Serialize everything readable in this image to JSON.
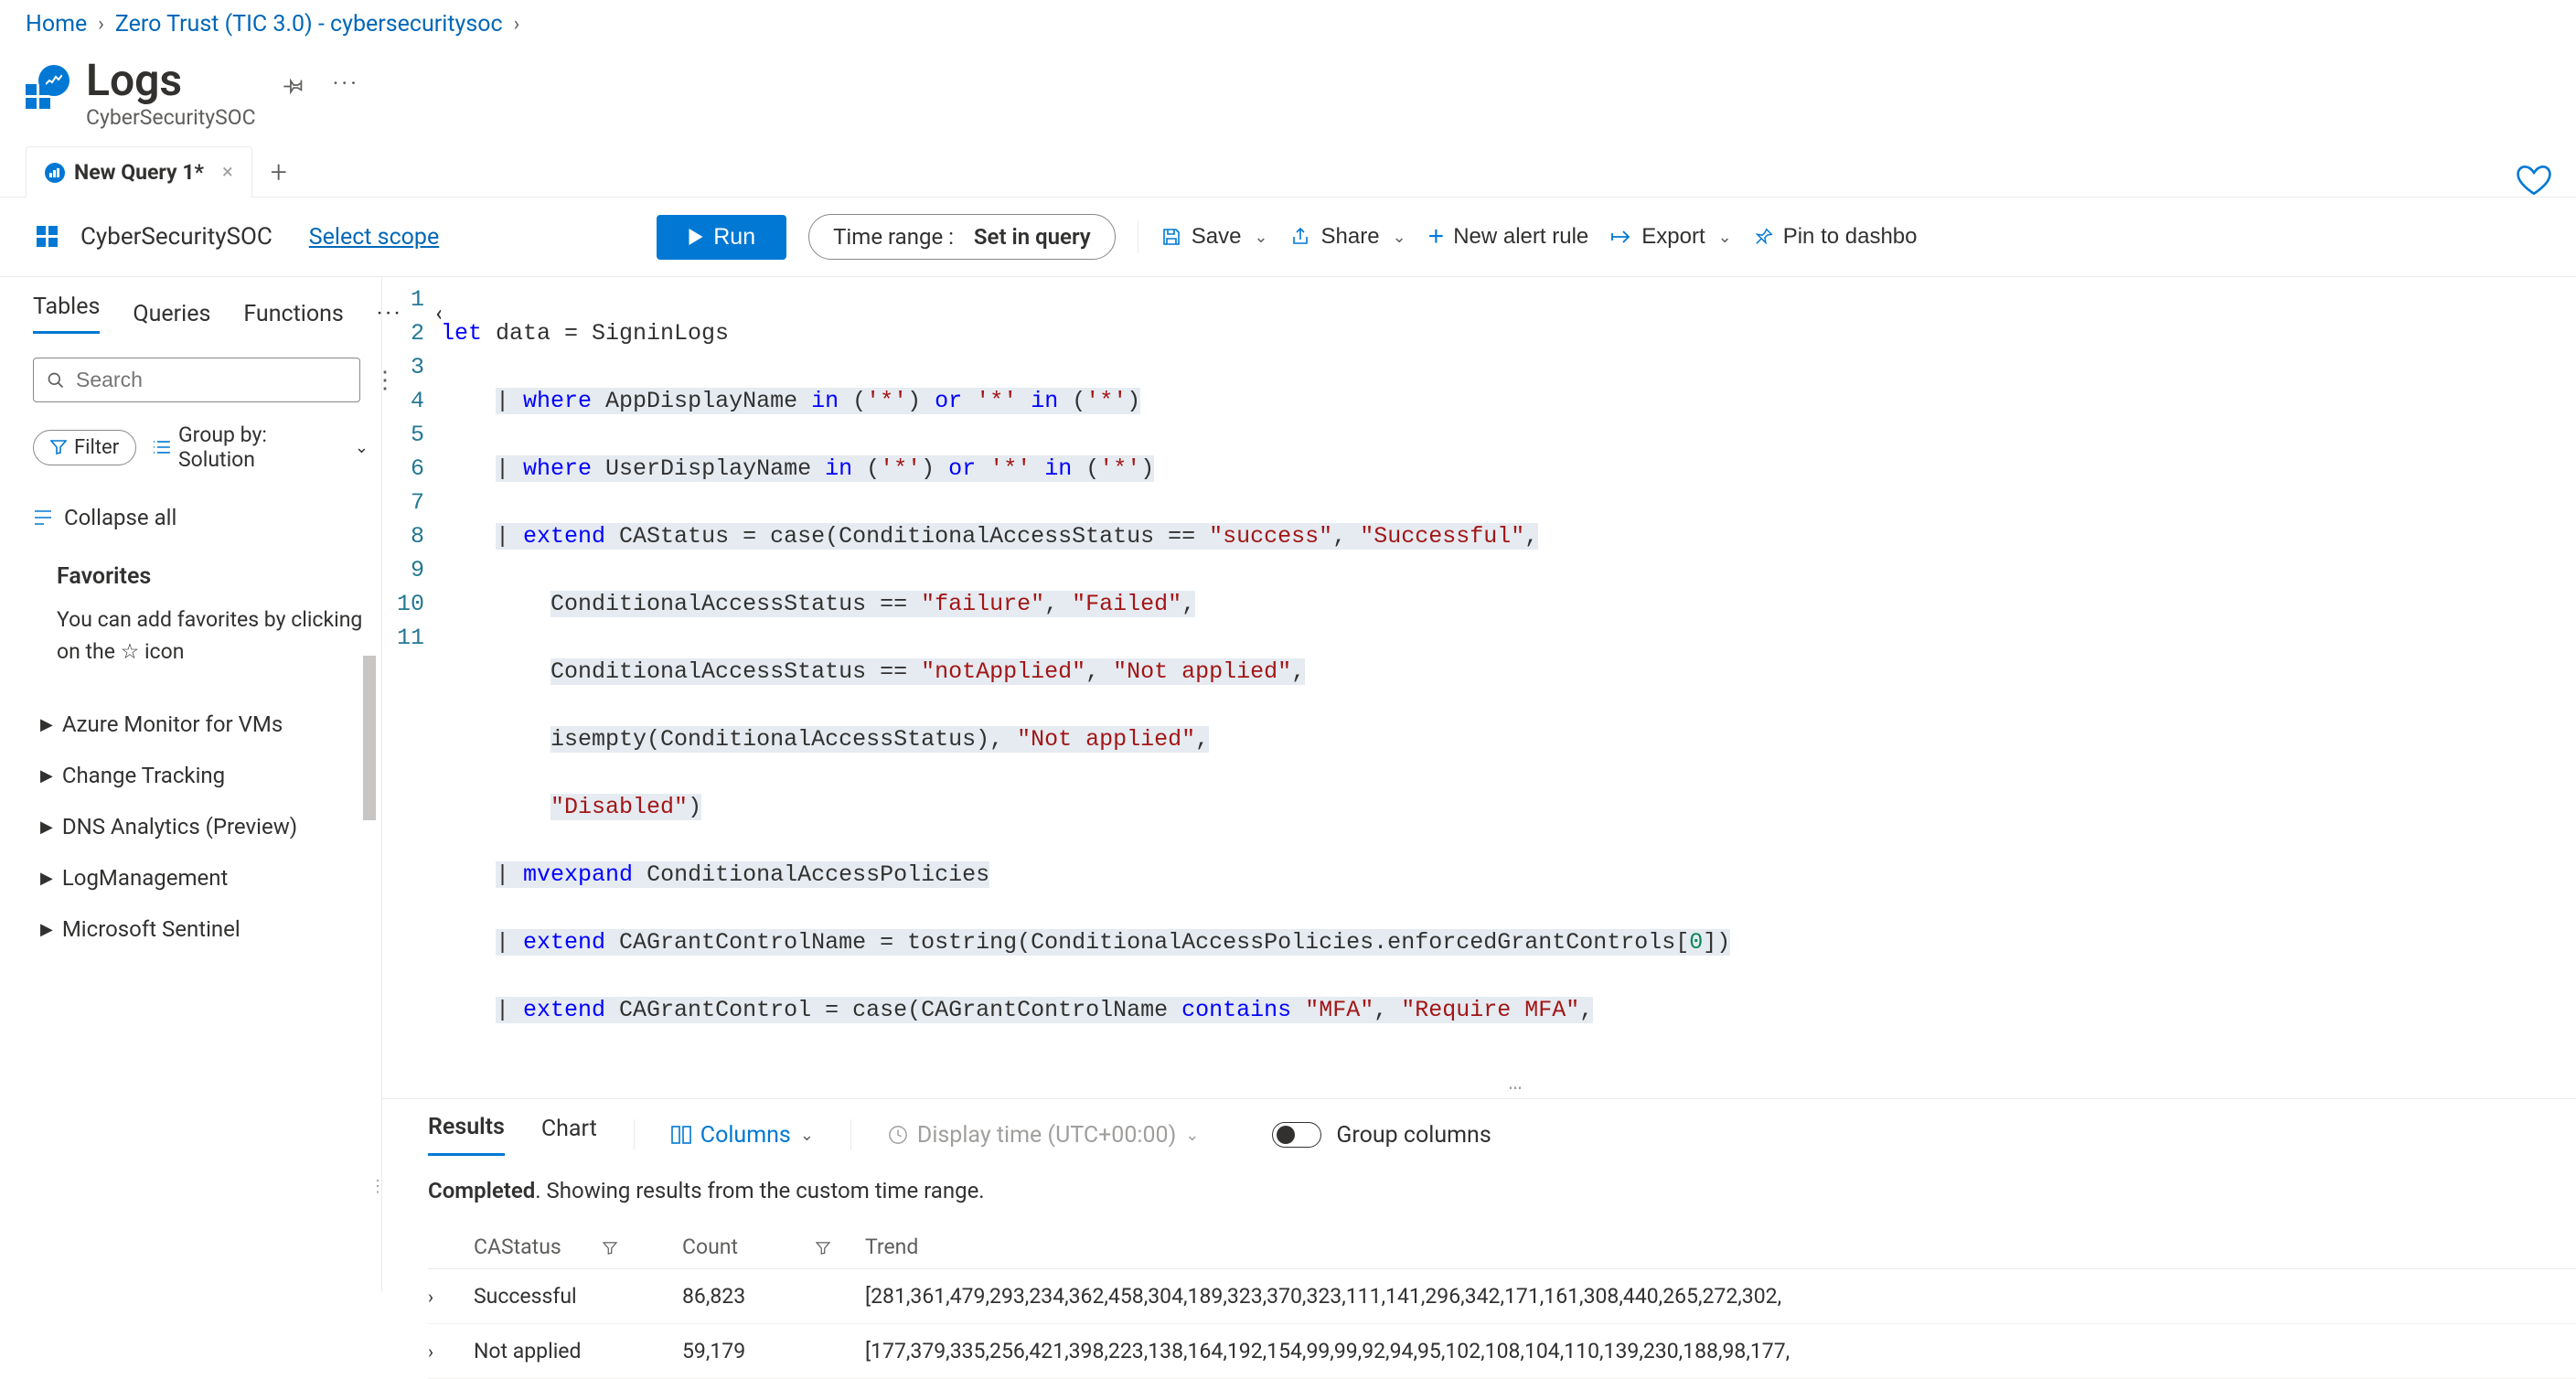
{
  "breadcrumb": {
    "home": "Home",
    "mid": "Zero Trust (TIC 3.0) - cybersecuritysoc"
  },
  "header": {
    "title": "Logs",
    "subtitle": "CyberSecuritySOC"
  },
  "tabs": {
    "query1": "New Query 1*"
  },
  "scope": {
    "name": "CyberSecuritySOC",
    "select": "Select scope"
  },
  "toolbar": {
    "run": "Run",
    "timerange_label": "Time range :",
    "timerange_value": "Set in query",
    "save": "Save",
    "share": "Share",
    "newalert": "New alert rule",
    "export": "Export",
    "pin": "Pin to dashbo"
  },
  "sidebar": {
    "tabs": {
      "tables": "Tables",
      "queries": "Queries",
      "functions": "Functions"
    },
    "search_placeholder": "Search",
    "filter": "Filter",
    "groupby": "Group by: Solution",
    "collapse_all": "Collapse all",
    "favorites_title": "Favorites",
    "favorites_hint": "You can add favorites by clicking on the ☆ icon",
    "tree": [
      "Azure Monitor for VMs",
      "Change Tracking",
      "DNS Analytics (Preview)",
      "LogManagement",
      "Microsoft Sentinel"
    ]
  },
  "editor": {
    "lines": [
      "let data = SigninLogs",
      "    | where AppDisplayName in ('*') or '*' in ('*')",
      "    | where UserDisplayName in ('*') or '*' in ('*')",
      "    | extend CAStatus = case(ConditionalAccessStatus == \"success\", \"Successful\",",
      "        ConditionalAccessStatus == \"failure\", \"Failed\",",
      "        ConditionalAccessStatus == \"notApplied\", \"Not applied\",",
      "        isempty(ConditionalAccessStatus), \"Not applied\",",
      "        \"Disabled\")",
      "    | mvexpand ConditionalAccessPolicies",
      "    | extend CAGrantControlName = tostring(ConditionalAccessPolicies.enforcedGrantControls[0])",
      "    | extend CAGrantControl = case(CAGrantControlName contains \"MFA\", \"Require MFA\","
    ]
  },
  "results": {
    "tab_results": "Results",
    "tab_chart": "Chart",
    "columns": "Columns",
    "displaytime": "Display time (UTC+00:00)",
    "groupcols": "Group columns",
    "status_bold": "Completed",
    "status_rest": ". Showing results from the custom time range.",
    "headers": {
      "castatus": "CAStatus",
      "count": "Count",
      "trend": "Trend"
    },
    "rows": [
      {
        "castatus": "Successful",
        "count": "86,823",
        "trend": "[281,361,479,293,234,362,458,304,189,323,370,323,111,141,296,342,171,161,308,440,265,272,302,"
      },
      {
        "castatus": "Not applied",
        "count": "59,179",
        "trend": "[177,379,335,256,421,398,223,138,164,192,154,99,99,92,94,95,102,108,104,110,139,230,188,98,177,"
      }
    ]
  }
}
